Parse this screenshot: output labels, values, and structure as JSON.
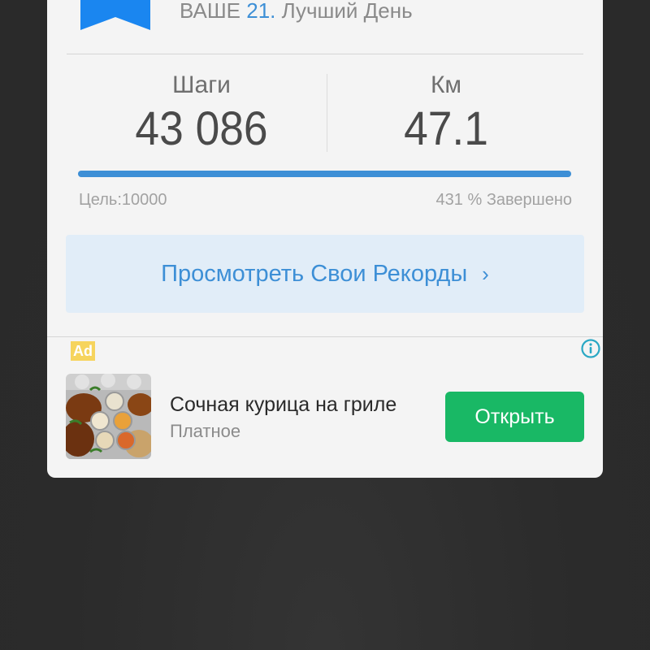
{
  "header": {
    "best_day_prefix": "ВАШЕ",
    "best_day_rank": "21.",
    "best_day_suffix": "Лучший День",
    "ribbon_icon": "bookmark-ribbon-icon",
    "ribbon_color": "#1a86f0"
  },
  "stats": {
    "steps_label": "Шаги",
    "steps_value": "43 086",
    "km_label": "Км",
    "km_value": "47.1"
  },
  "progress": {
    "goal_text": "Цель:10000",
    "complete_text": "431 % Завершено",
    "fill_fraction": 1.0,
    "color": "#3d8fd6"
  },
  "records": {
    "label": "Просмотреть Свои Рекорды",
    "chevron": "›",
    "chevron_icon": "chevron-right-icon"
  },
  "ad": {
    "badge": "Ad",
    "info_icon": "info-icon",
    "title": "Сочная курица на гриле",
    "subtitle": "Платное",
    "button_label": "Открыть",
    "button_color": "#19b865"
  }
}
